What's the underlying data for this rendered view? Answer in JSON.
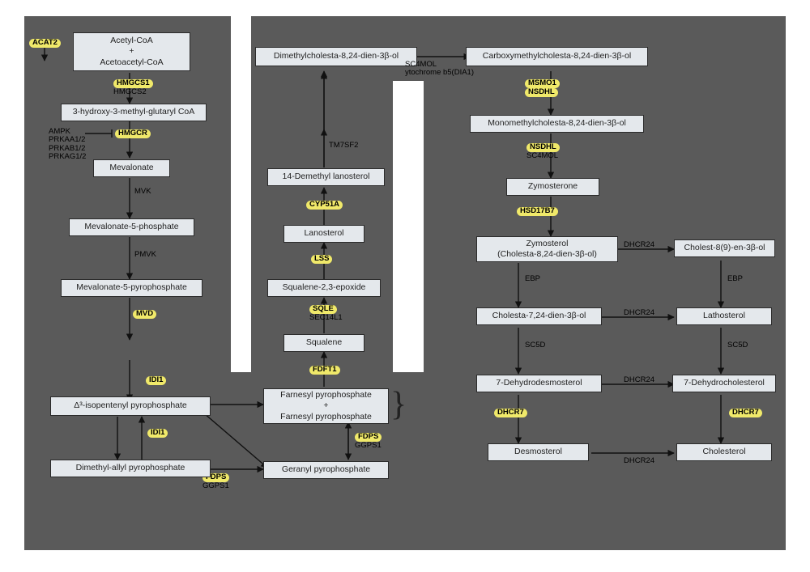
{
  "nodes": {
    "acetyl": "Acetyl-CoA\n+\nAcetoacetyl-CoA",
    "hmgcoa": "3-hydroxy-3-methyl-glutaryl CoA",
    "meval": "Mevalonate",
    "m5p": "Mevalonate-5-phosphate",
    "m5pp": "Mevalonate-5-pyrophosphate",
    "ipp": "Δ³-isopentenyl pyrophosphate",
    "dmapp": "Dimethyl-allyl pyrophosphate",
    "gpp": "Geranyl pyrophosphate",
    "fpp": "Farnesyl pyrophosphate\n+\nFarnesyl pyrophosphate",
    "squalene": "Squalene",
    "sqepox": "Squalene-2,3-epoxide",
    "lanost": "Lanosterol",
    "demeth14": "14-Demethyl lanosterol",
    "dimeth": "Dimethylcholesta-8,24-dien-3β-ol",
    "carboxy": "Carboxymethylcholesta-8,24-dien-3β-ol",
    "monometh": "Monomethylcholesta-8,24-dien-3β-ol",
    "zymoster1": "Zymosterone",
    "zymoster2": "Zymosterol\n(Cholesta-8,24-dien-3β-ol)",
    "cholest8": "Cholest-8(9)-en-3β-ol",
    "chol724": "Cholesta-7,24-dien-3β-ol",
    "lathost": "Lathosterol",
    "dehyddesm": "7-Dehydrodesmosterol",
    "dehydchol": "7-Dehydrocholesterol",
    "desmost": "Desmosterol",
    "cholest": "Cholesterol"
  },
  "enz": {
    "acat2": "ACAT2",
    "hmgcs1": "HMGCS1",
    "hmgcs2": "HMGCS2",
    "hmgcr": "HMGCR",
    "ampk": "AMPK",
    "prkaa": "PRKAA1/2",
    "prkab": "PRKAB1/2",
    "prkag": "PRKAG1/2",
    "mvk": "MVK",
    "pmvk": "PMVK",
    "mvd": "MVD",
    "idi1": "IDI1",
    "fdps": "FDPS",
    "ggps1": "GGPS1",
    "fdft1": "FDFT1",
    "sqle": "SQLE",
    "sec14": "SEC14L1",
    "lss": "LSS",
    "cyp51a": "CYP51A",
    "tm7sf2": "TM7SF2",
    "sc4mol": "SC4MOL",
    "cytb5": "ytochrome b5(DIA1)",
    "msmo1": "MSMO1",
    "nsdhl": "NSDHL",
    "nsdhl2": "NSDHL",
    "sc4mol2": "SC4MOL",
    "hsd17b7": "HSD17B7",
    "dhcr24": "DHCR24",
    "ebp": "EBP",
    "sc5d": "SC5D",
    "dhcr7": "DHCR7"
  }
}
